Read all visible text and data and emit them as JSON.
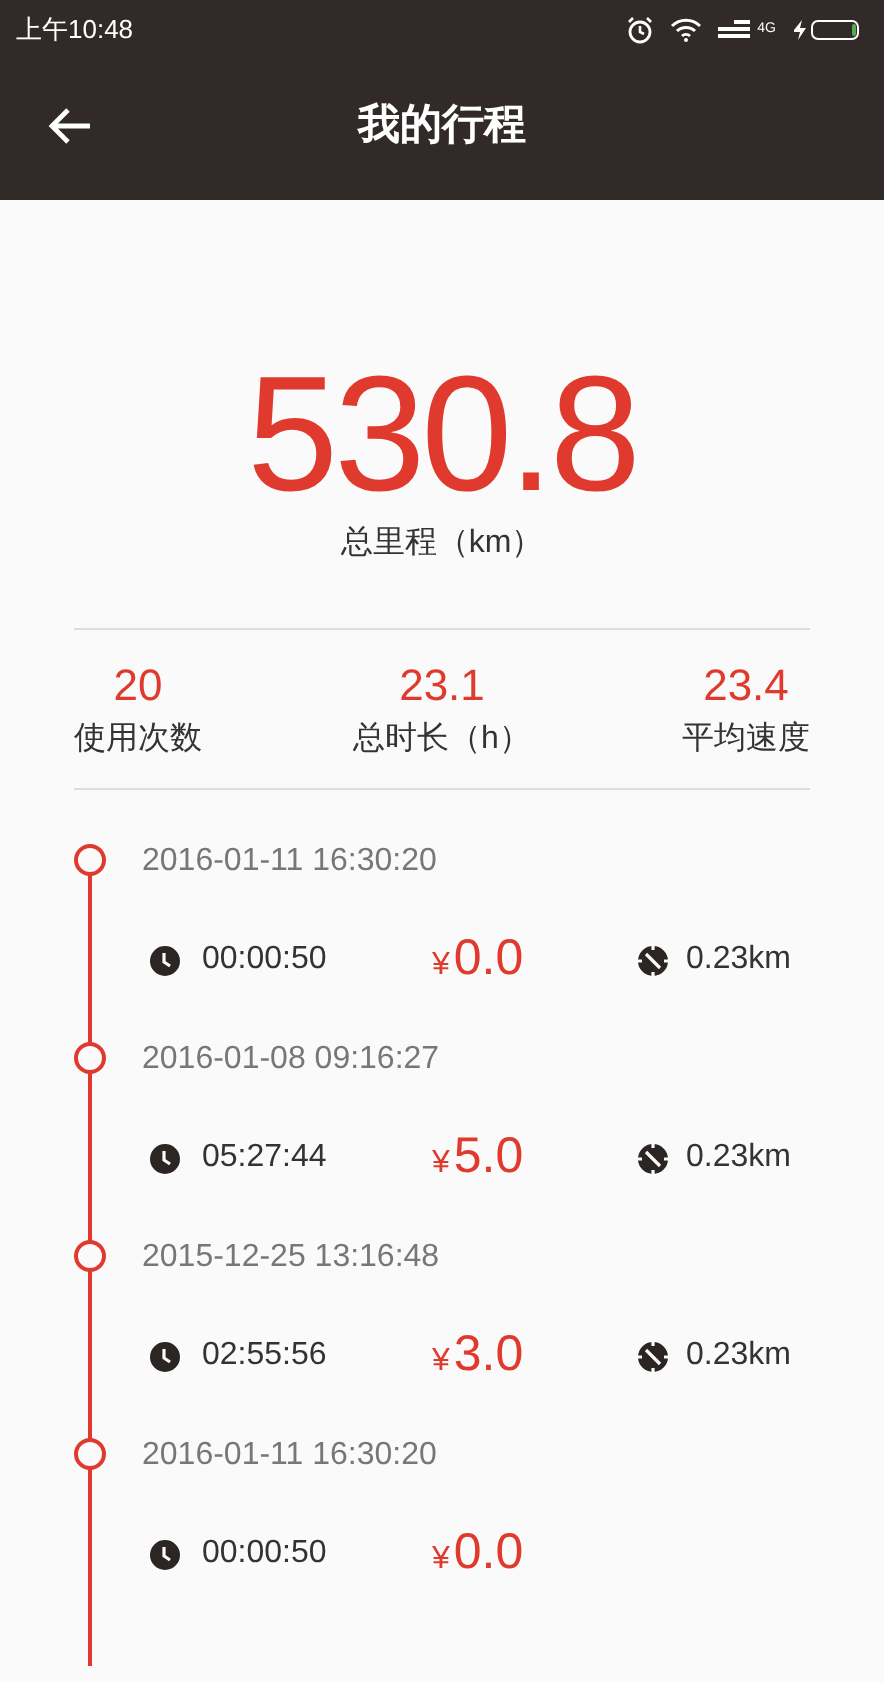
{
  "status_bar": {
    "time": "上午10:48",
    "network": "4G"
  },
  "header": {
    "title": "我的行程"
  },
  "summary": {
    "value": "530.8",
    "label": "总里程（km）"
  },
  "stats": [
    {
      "value": "20",
      "label": "使用次数"
    },
    {
      "value": "23.1",
      "label": "总时长（h）"
    },
    {
      "value": "23.4",
      "label": "平均速度"
    }
  ],
  "trips": [
    {
      "datetime": "2016-01-11 16:30:20",
      "duration": "00:00:50",
      "currency": "¥",
      "price": "0.0",
      "distance": "0.23km"
    },
    {
      "datetime": "2016-01-08 09:16:27",
      "duration": "05:27:44",
      "currency": "¥",
      "price": "5.0",
      "distance": "0.23km"
    },
    {
      "datetime": "2015-12-25 13:16:48",
      "duration": "02:55:56",
      "currency": "¥",
      "price": "3.0",
      "distance": "0.23km"
    },
    {
      "datetime": "2016-01-11 16:30:20",
      "duration": "00:00:50",
      "currency": "¥",
      "price": "0.0"
    }
  ]
}
